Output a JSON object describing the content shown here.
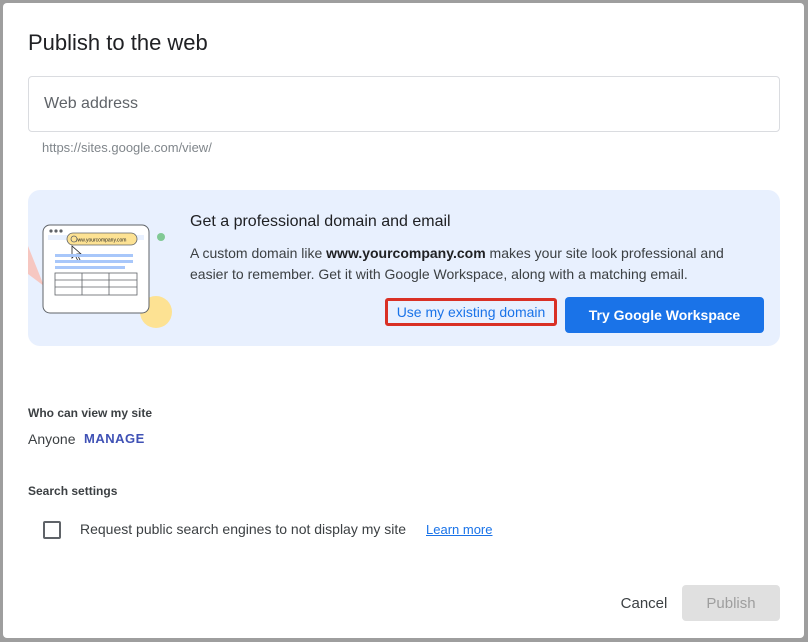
{
  "dialog": {
    "title": "Publish to the web"
  },
  "web_address": {
    "placeholder": "Web address",
    "value": "",
    "hint": "https://sites.google.com/view/"
  },
  "promo": {
    "illustration_url_text": "www.yourcompany.com",
    "title": "Get a professional domain and email",
    "body_prefix": "A custom domain like ",
    "body_bold": "www.yourcompany.com",
    "body_suffix": " makes your site look professional and easier to remember. Get it with Google Workspace, along with a matching email.",
    "existing_domain_label": "Use my existing domain",
    "workspace_label": "Try Google Workspace"
  },
  "visibility": {
    "label": "Who can view my site",
    "value": "Anyone",
    "manage_label": "MANAGE"
  },
  "search": {
    "label": "Search settings",
    "checkbox_label": "Request public search engines to not display my site",
    "checked": false,
    "learn_more": "Learn more"
  },
  "footer": {
    "cancel_label": "Cancel",
    "publish_label": "Publish"
  },
  "colors": {
    "accent": "#1a73e8",
    "promo_bg": "#e8f0fe",
    "highlight": "#d93025",
    "manage": "#3f51b5"
  }
}
